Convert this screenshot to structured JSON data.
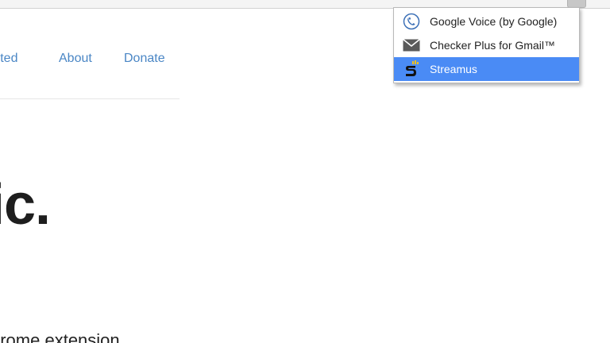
{
  "site": {
    "nav": {
      "getting_started": "arted",
      "about": "About",
      "donate": "Donate"
    },
    "hero": {
      "title": "ic.",
      "subtitle": "hrome extension"
    }
  },
  "extension_menu": {
    "items": [
      {
        "label": "Google Voice (by Google)",
        "icon": "google-voice-icon",
        "active": false
      },
      {
        "label": "Checker Plus for Gmail™",
        "icon": "mail-envelope-icon",
        "active": false
      },
      {
        "label": "Streamus",
        "icon": "streamus-icon",
        "active": true
      }
    ],
    "highlight_color": "#4a8bf5"
  },
  "colors": {
    "link": "#4a86c5",
    "heading": "#1e1e1e"
  }
}
